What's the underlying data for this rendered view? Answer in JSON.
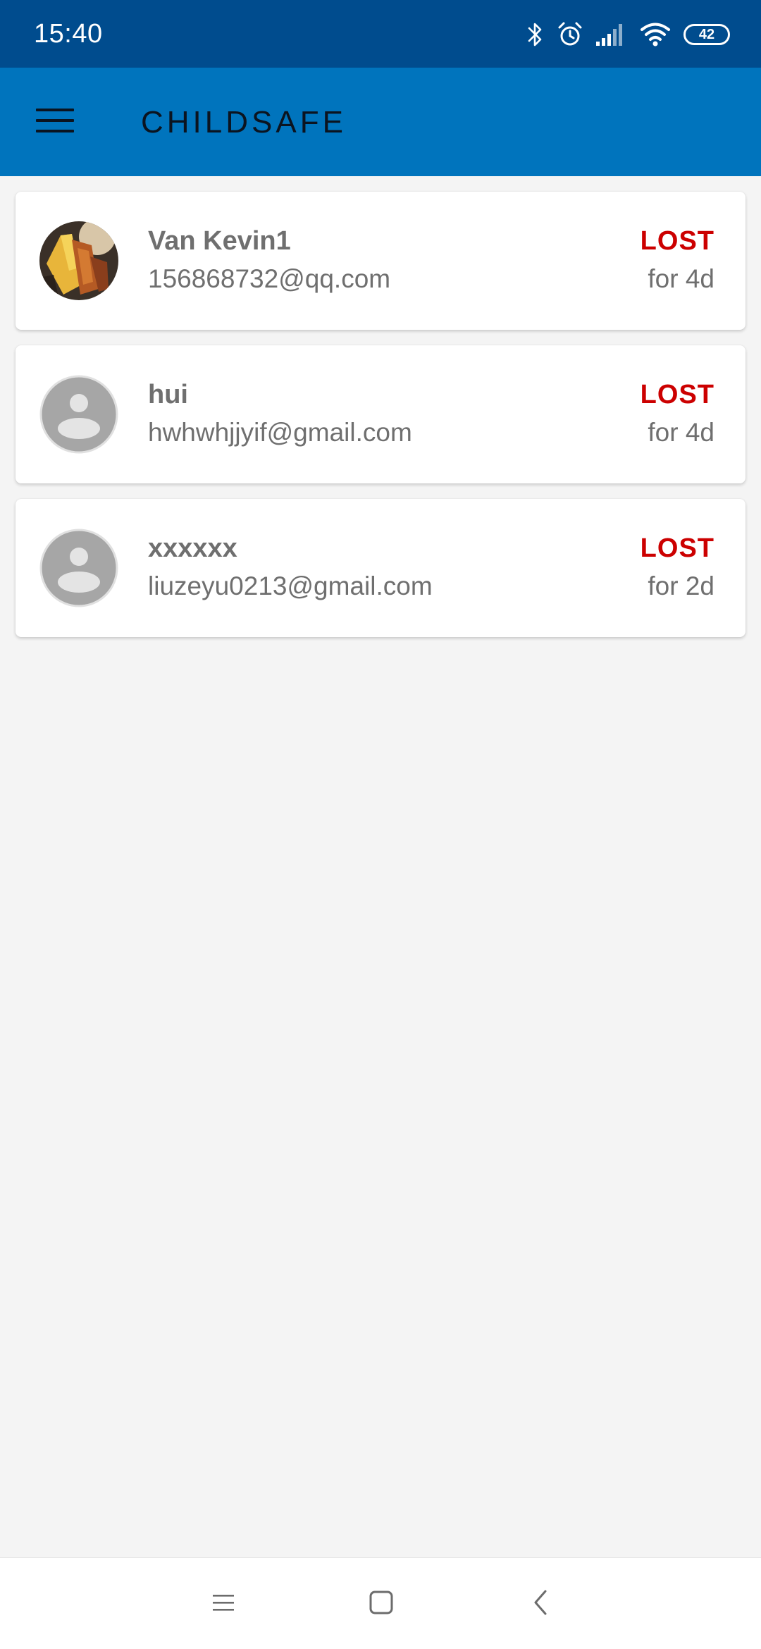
{
  "status_bar": {
    "time": "15:40",
    "battery_level": "42",
    "icons": [
      "bluetooth-icon",
      "alarm-icon",
      "signal-icon",
      "wifi-icon",
      "battery-icon"
    ]
  },
  "app_bar": {
    "title": "CHILDSAFE",
    "menu_icon": "hamburger-menu-icon"
  },
  "children": [
    {
      "name": "Van Kevin1",
      "email": "156868732@qq.com",
      "status": "LOST",
      "duration": "for 4d",
      "avatar": "photo"
    },
    {
      "name": "hui",
      "email": "hwhwhjjyif@gmail.com",
      "status": "LOST",
      "duration": "for 4d",
      "avatar": "default-person-icon"
    },
    {
      "name": "xxxxxx",
      "email": "liuzeyu0213@gmail.com",
      "status": "LOST",
      "duration": "for 2d",
      "avatar": "default-person-icon"
    }
  ],
  "nav_bar": {
    "buttons": [
      "recents-icon",
      "home-icon",
      "back-icon"
    ]
  },
  "colors": {
    "status_bar_bg": "#004c8e",
    "app_bar_bg": "#0074bd",
    "lost_status": "#cc0000",
    "secondary_text": "#6f6f6f",
    "page_bg": "#f4f4f4"
  }
}
